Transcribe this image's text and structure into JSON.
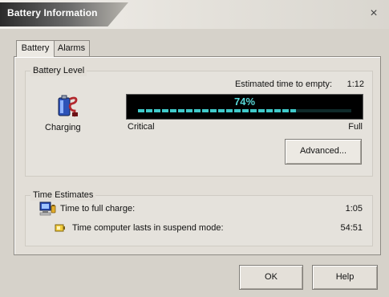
{
  "window": {
    "title": "Battery Information",
    "close_glyph": "×"
  },
  "tabs": [
    {
      "label": "Battery",
      "active": true
    },
    {
      "label": "Alarms",
      "active": false
    }
  ],
  "battery_level": {
    "group_label": "Battery Level",
    "status": "Charging",
    "estimated_label": "Estimated time to empty:",
    "estimated_value": "1:12",
    "percent_text": "74%",
    "percent_value": 74,
    "min_label": "Critical",
    "max_label": "Full",
    "advanced_button": "Advanced...",
    "icon": "battery-charging-icon",
    "meter_color": "#3fc9c9"
  },
  "time_estimates": {
    "group_label": "Time Estimates",
    "rows": [
      {
        "label": "Time to full charge:",
        "value": "1:05",
        "icon": "computer-icon"
      },
      {
        "label": "Time computer lasts in suspend mode:",
        "value": "54:51",
        "icon": "suspend-icon"
      }
    ]
  },
  "buttons": {
    "ok": "OK",
    "help": "Help"
  }
}
